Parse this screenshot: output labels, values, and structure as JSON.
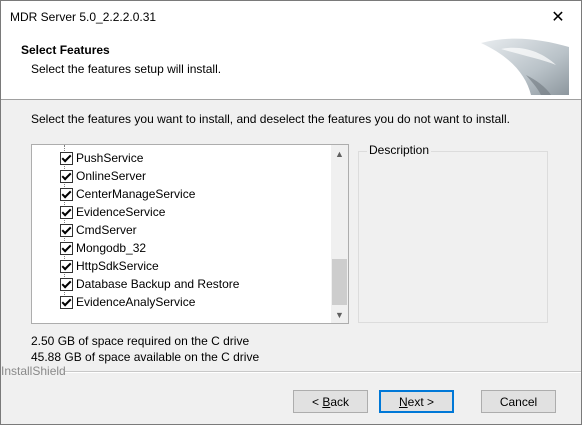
{
  "window": {
    "title": "MDR Server 5.0_2.2.2.0.31",
    "close_glyph": "✕"
  },
  "header": {
    "title": "Select Features",
    "subtitle": "Select the features setup will install."
  },
  "instruction": "Select the features you want to install, and deselect the features you do not want to install.",
  "features": [
    {
      "label": "PushService",
      "checked": true
    },
    {
      "label": "OnlineServer",
      "checked": true
    },
    {
      "label": "CenterManageService",
      "checked": true
    },
    {
      "label": "EvidenceService",
      "checked": true
    },
    {
      "label": "CmdServer",
      "checked": true
    },
    {
      "label": "Mongodb_32",
      "checked": true
    },
    {
      "label": "HttpSdkService",
      "checked": true
    },
    {
      "label": "Database Backup and Restore",
      "checked": true
    },
    {
      "label": "EvidenceAnalyService",
      "checked": true
    }
  ],
  "description_label": "Description",
  "space_required": "2.50 GB of space required on the C drive",
  "space_available": "45.88 GB of space available on the C drive",
  "installshield_label": "InstallShield",
  "buttons": {
    "back": {
      "prefix": "< ",
      "accel": "B",
      "rest": "ack"
    },
    "next": {
      "accel": "N",
      "rest": "ext >"
    },
    "cancel": "Cancel"
  },
  "icons": {
    "scroll_up": "up-arrow-icon",
    "scroll_down": "down-arrow-icon",
    "header_graphic": "installer-graphic-icon"
  }
}
